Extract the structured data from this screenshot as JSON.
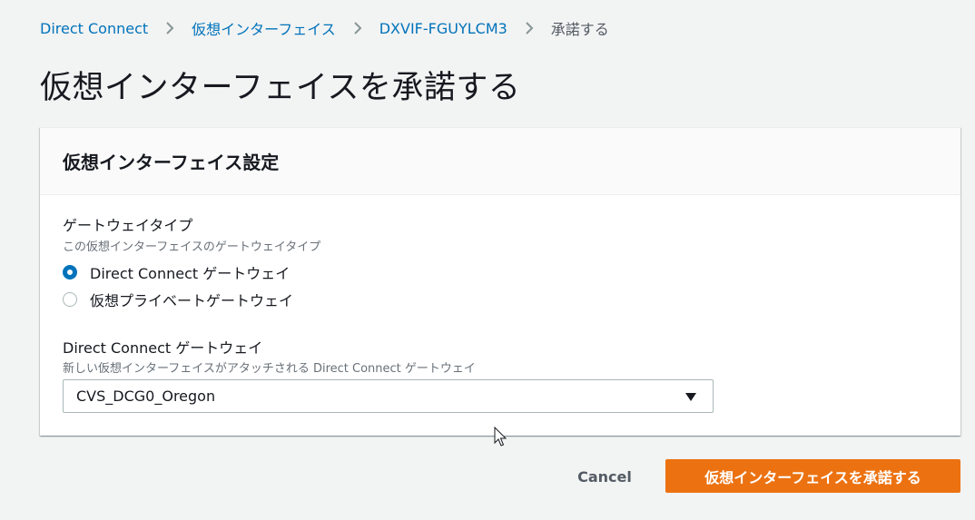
{
  "breadcrumb": {
    "items": [
      {
        "label": "Direct Connect"
      },
      {
        "label": "仮想インターフェイス"
      },
      {
        "label": "DXVIF-FGUYLCM3"
      }
    ],
    "current": "承諾する",
    "separator_icon": "chevron-right-icon"
  },
  "page": {
    "title": "仮想インターフェイスを承諾する"
  },
  "panel": {
    "title": "仮想インターフェイス設定",
    "gateway_type": {
      "label": "ゲートウェイタイプ",
      "description": "この仮想インターフェイスのゲートウェイタイプ",
      "options": [
        {
          "label": "Direct Connect ゲートウェイ",
          "selected": true
        },
        {
          "label": "仮想プライベートゲートウェイ",
          "selected": false
        }
      ]
    },
    "dc_gateway": {
      "label": "Direct Connect ゲートウェイ",
      "description": "新しい仮想インターフェイスがアタッチされる Direct Connect ゲートウェイ",
      "selected_value": "CVS_DCG0_Oregon",
      "caret_icon": "caret-down-icon"
    }
  },
  "actions": {
    "cancel_label": "Cancel",
    "submit_label": "仮想インターフェイスを承諾する"
  },
  "colors": {
    "background": "#f2f3f3",
    "link": "#0073bb",
    "primary": "#ec7211",
    "panel_header": "#fafafa"
  }
}
